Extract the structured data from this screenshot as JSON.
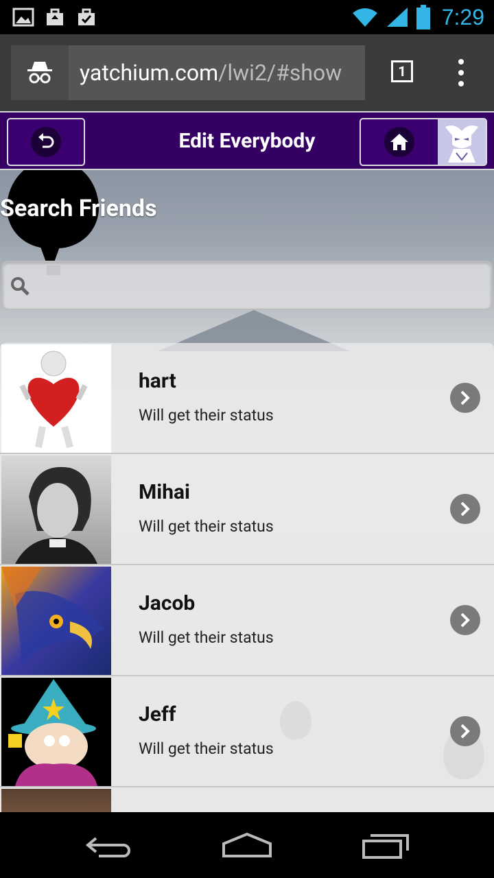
{
  "status_bar": {
    "time": "7:29",
    "icons": [
      "image-icon",
      "briefcase-upload-icon",
      "briefcase-check-icon",
      "wifi-icon",
      "signal-icon",
      "battery-icon"
    ]
  },
  "browser": {
    "url_host": "yatchium.com",
    "url_path": "/lwi2/#show",
    "tab_count": "1"
  },
  "header": {
    "title": "Edit Everybody",
    "back_icon": "undo-icon",
    "home_icon": "home-icon"
  },
  "search": {
    "heading": "Search Friends",
    "placeholder": "",
    "value": ""
  },
  "friends": [
    {
      "name": "hart",
      "status": "Will get their status"
    },
    {
      "name": "Mihai",
      "status": "Will get their status"
    },
    {
      "name": "Jacob",
      "status": "Will get their status"
    },
    {
      "name": "Jeff",
      "status": "Will get their status"
    }
  ],
  "colors": {
    "header_bg": "#340064",
    "time": "#33b5e5"
  }
}
